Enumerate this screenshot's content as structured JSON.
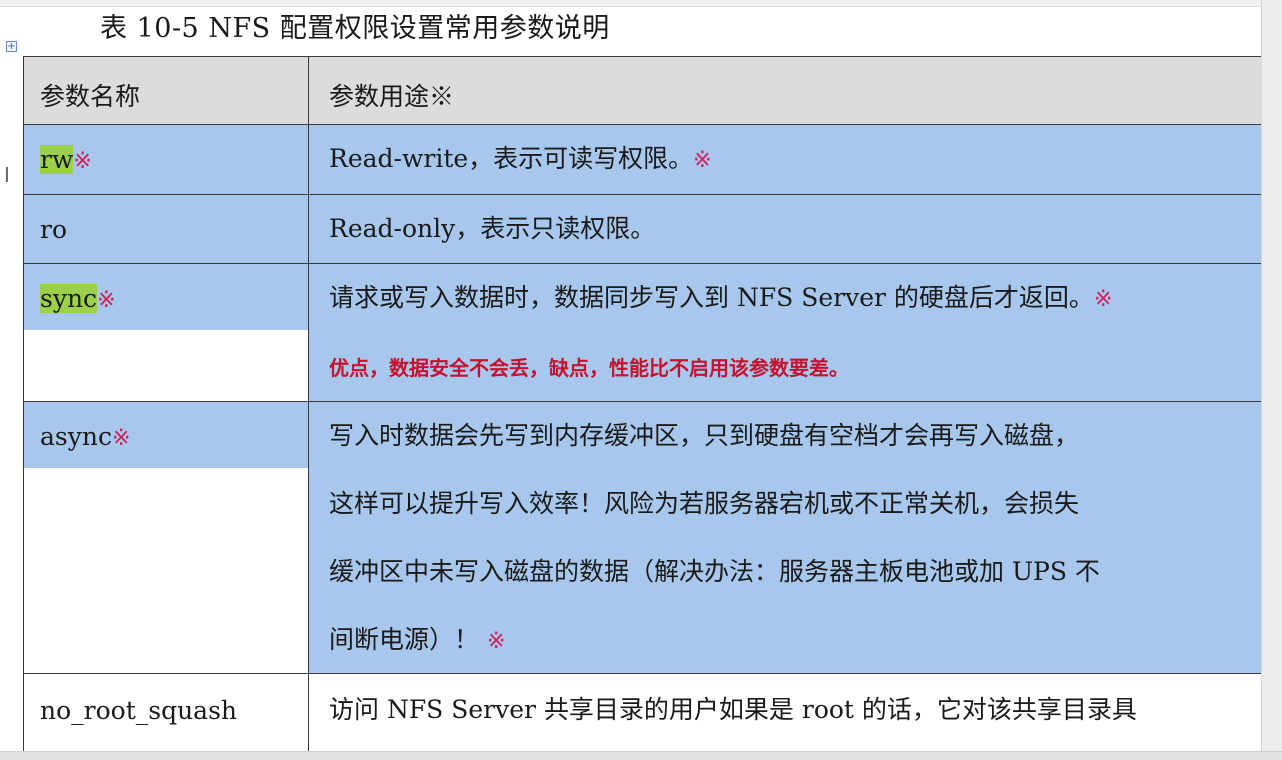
{
  "caption": "表 10-5 NFS 配置权限设置常用参数说明",
  "header": {
    "col_name": "参数名称",
    "col_use": "参数用途※"
  },
  "rows": [
    {
      "name": "rw",
      "name_mark": "※",
      "desc": "Read-write，表示可读写权限。",
      "desc_mark": "※"
    },
    {
      "name": "ro",
      "desc": "Read-only，表示只读权限。"
    },
    {
      "name": "sync",
      "name_mark": "※",
      "desc": "请求或写入数据时，数据同步写入到 NFS Server 的硬盘后才返回。",
      "desc_mark": "※",
      "note": "优点，数据安全不会丢，缺点，性能比不启用该参数要差。"
    },
    {
      "name": "async",
      "name_mark": "※",
      "desc_lines": [
        "写入时数据会先写到内存缓冲区，只到硬盘有空档才会再写入磁盘，",
        "这样可以提升写入效率！风险为若服务器宕机或不正常关机，会损失",
        "缓冲区中未写入磁盘的数据（解决办法：服务器主板电池或加 UPS 不",
        "间断电源）！"
      ],
      "desc_mark": "※"
    },
    {
      "name": "no_root_squash",
      "desc": "访问 NFS Server 共享目录的用户如果是 root 的话，它对该共享目录具"
    }
  ],
  "icons": {
    "table_handle": "table-move-handle-icon",
    "cursor": "text-cursor-icon"
  },
  "colors": {
    "highlight_blue": "#a7c8ec",
    "highlight_green": "#9bd04a",
    "mark_red": "#d01f5a",
    "note_red": "#c8102e",
    "header_gray": "#dcdcdc"
  }
}
